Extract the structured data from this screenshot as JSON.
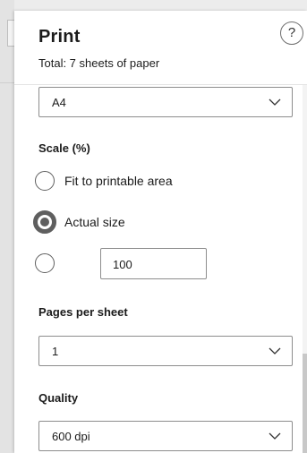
{
  "dialog": {
    "title": "Print",
    "subtitle": "Total: 7 sheets of paper",
    "help_glyph": "?"
  },
  "paper_size": {
    "value": "A4"
  },
  "scale": {
    "label": "Scale (%)",
    "options": [
      {
        "label": "Fit to printable area",
        "selected": false
      },
      {
        "label": "Actual size",
        "selected": true
      }
    ],
    "custom_value": "100"
  },
  "pages_per_sheet": {
    "label": "Pages per sheet",
    "value": "1"
  },
  "quality": {
    "label": "Quality",
    "value": "600 dpi"
  },
  "icons": {
    "help": "help-icon",
    "dropdown": "chevron-down-icon"
  }
}
